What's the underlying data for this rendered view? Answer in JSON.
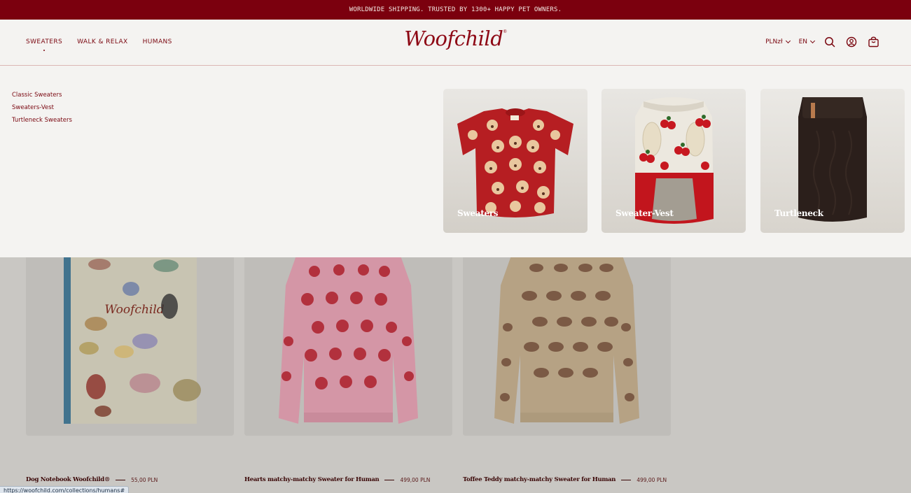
{
  "announcement": "WORLDWIDE SHIPPING. TRUSTED BY 1300+ HAPPY PET OWNERS.",
  "nav": {
    "items": [
      {
        "label": "SWEATERS"
      },
      {
        "label": "WALK & RELAX"
      },
      {
        "label": "HUMANS"
      }
    ]
  },
  "brand": {
    "name": "Woofchild",
    "mark": "®"
  },
  "utilities": {
    "currency": "PLNzł",
    "language": "EN",
    "icons": [
      "search-icon",
      "account-icon",
      "cart-icon"
    ]
  },
  "mega_menu": {
    "links": [
      "Classic Sweaters",
      "Sweaters-Vest",
      "Turtleneck Sweaters"
    ],
    "cards": [
      {
        "label": "Sweaters",
        "image": "red teddy bear dog sweater"
      },
      {
        "label": "Sweater-Vest",
        "image": "cherry dog sweater vest"
      },
      {
        "label": "Turtleneck",
        "image": "brown turtleneck dog sweater"
      }
    ]
  },
  "products": [
    {
      "title": "Dog Notebook Woofchild®",
      "price": "55,00 PLN"
    },
    {
      "title": "Hearts matchy-matchy Sweater for Human",
      "price": "499,00 PLN"
    },
    {
      "title": "Toffee Teddy matchy-matchy Sweater for Human",
      "price": "499,00 PLN"
    }
  ],
  "status_url": "https://woofchild.com/collections/humans#",
  "colors": {
    "brand": "#7b000e",
    "background": "#f4f3f1",
    "overlay": "#c9c7c3"
  }
}
